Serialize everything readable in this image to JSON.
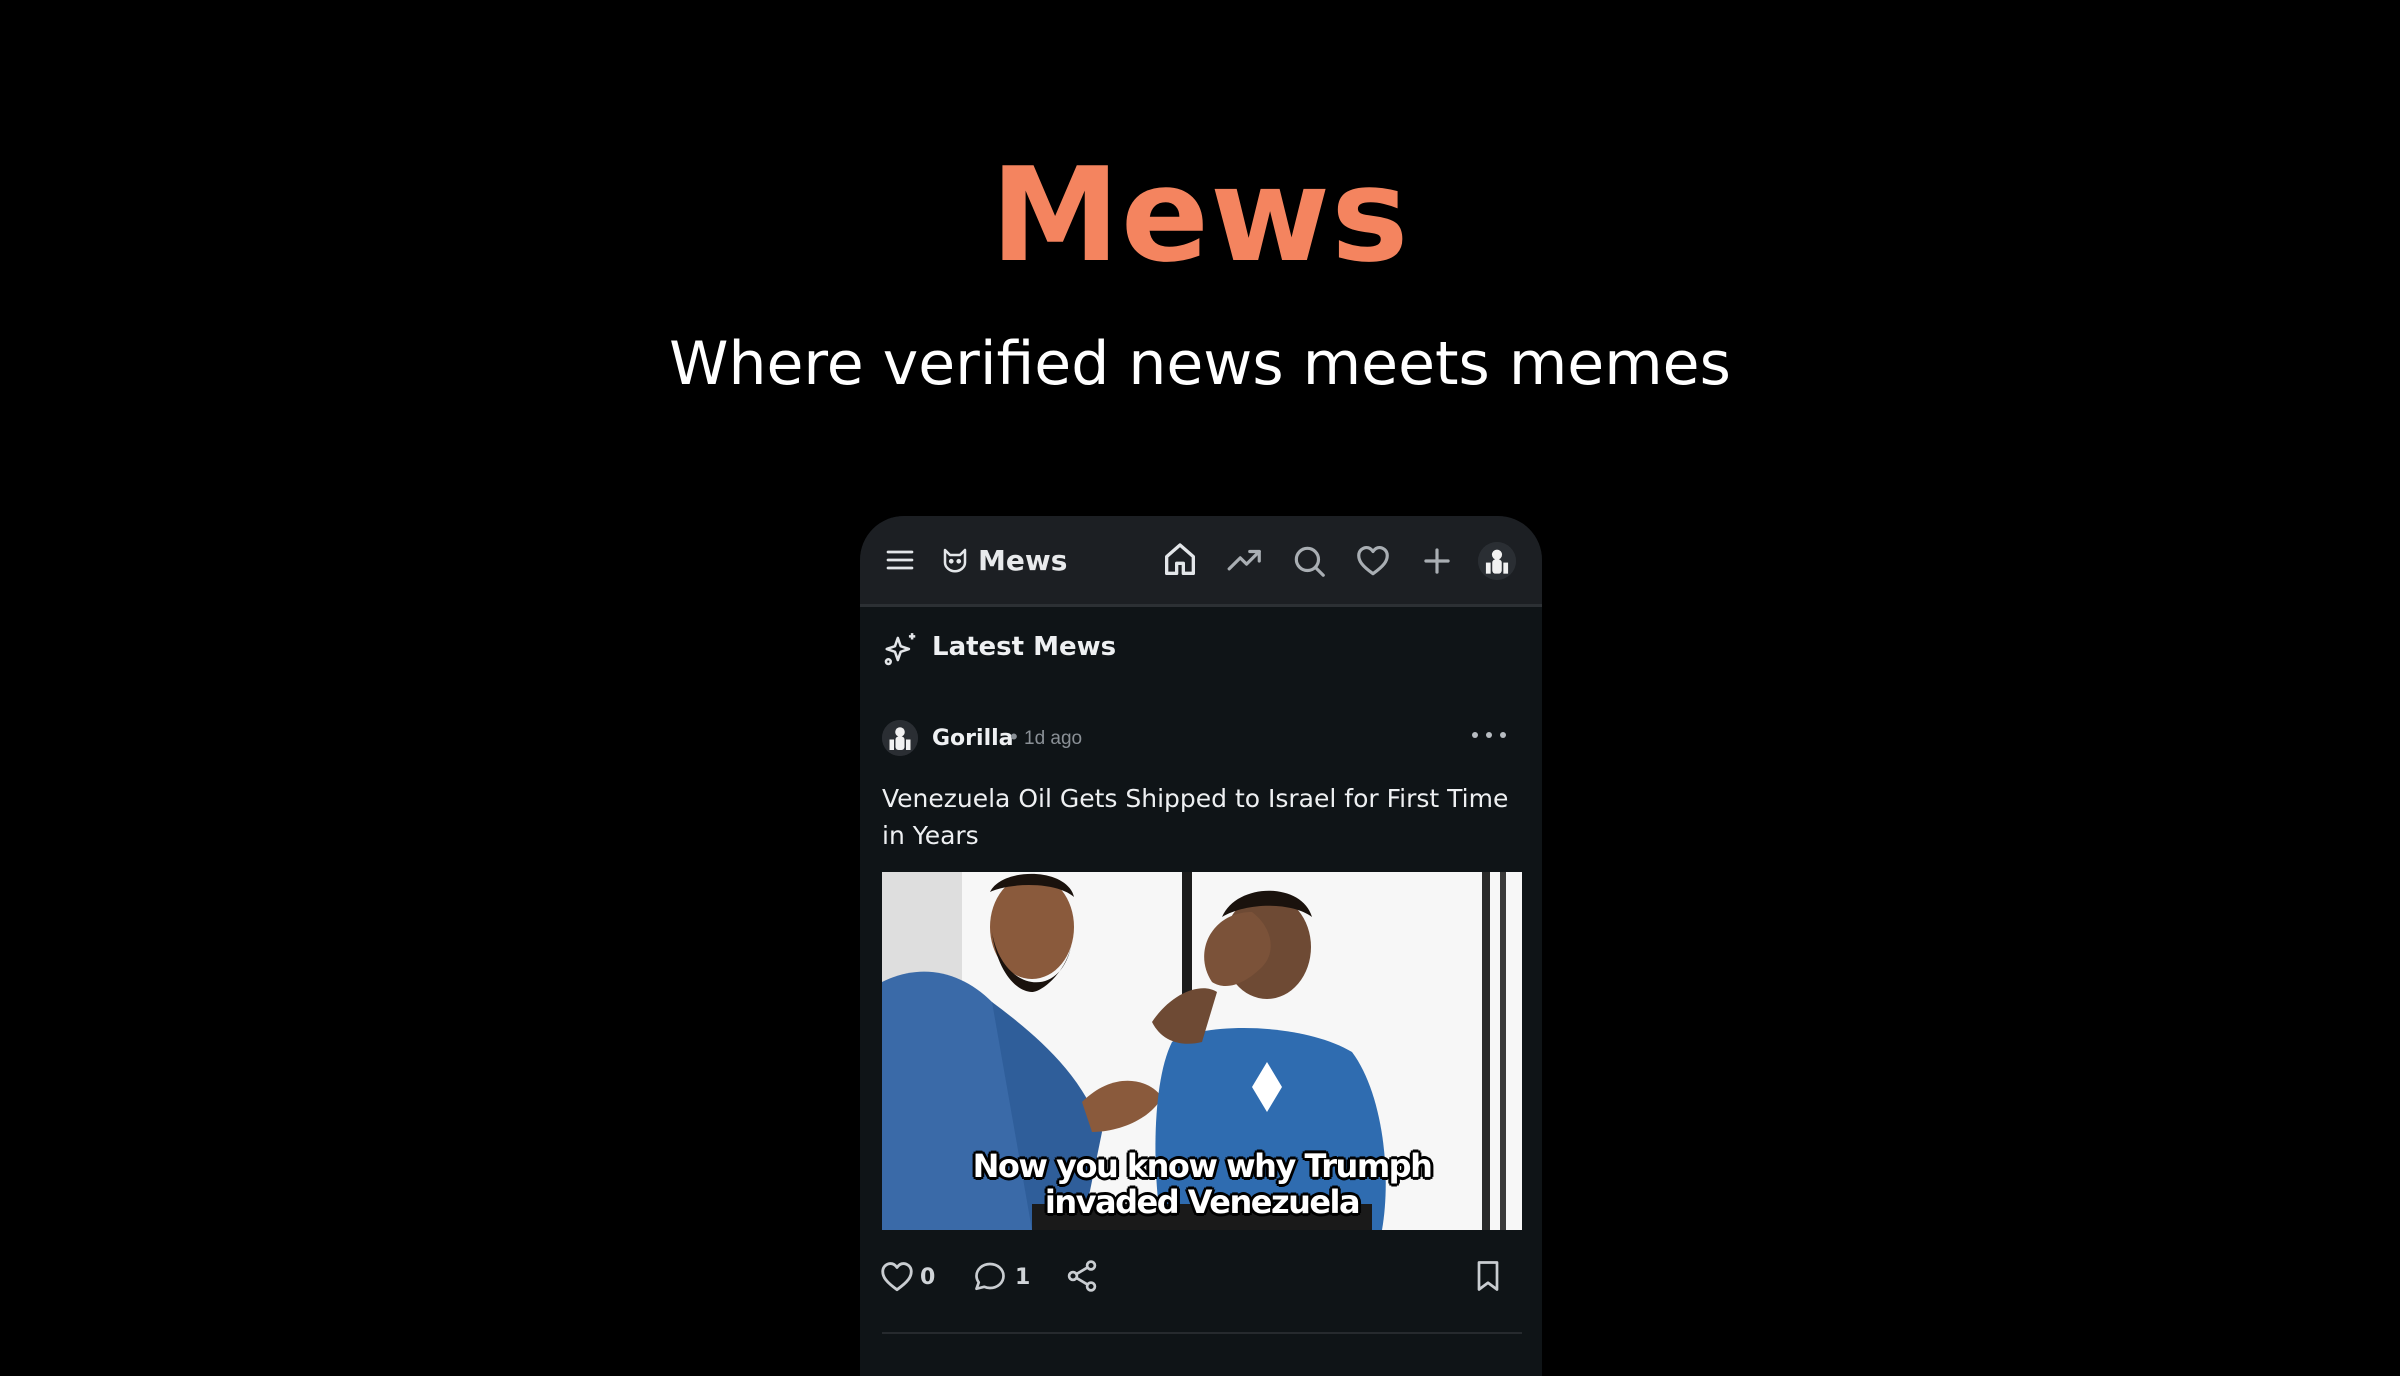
{
  "hero": {
    "title": "Mews",
    "subtitle": "Where verified news meets memes"
  },
  "app": {
    "brand": "Mews",
    "nav_icons": [
      "menu-icon",
      "cat-logo-icon",
      "home-icon",
      "trending-icon",
      "search-icon",
      "heart-icon",
      "plus-icon",
      "avatar"
    ],
    "section_title": "Latest Mews"
  },
  "post": {
    "author": "Gorilla",
    "separator": "•",
    "time": "1d ago",
    "title": "Venezuela Oil Gets Shipped to Israel for First Time in Years",
    "meme_caption_line1": "Now you know why Trumph",
    "meme_caption_line2": "invaded Venezuela",
    "likes": "0",
    "comments": "1"
  },
  "colors": {
    "accent": "#f4845f",
    "page_bg": "#000000",
    "app_bg": "#0f1417",
    "topbar_bg": "#1c1f23",
    "text": "#eef0f2",
    "muted": "#8a9096"
  }
}
